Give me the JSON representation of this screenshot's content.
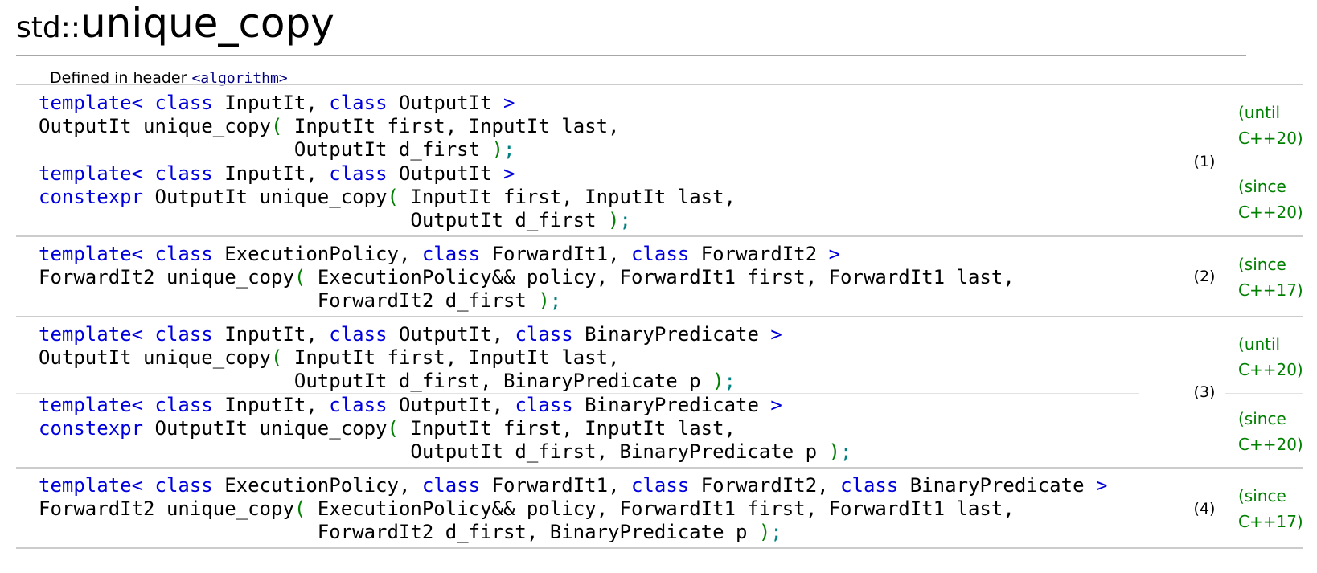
{
  "title": {
    "ns": "std::",
    "name": "unique_copy"
  },
  "header": {
    "prefix": "Defined in header ",
    "name": "<algorithm>"
  },
  "kw": {
    "template": "template",
    "class": "class",
    "constexpr": "constexpr"
  },
  "punct": {
    "lt": "< ",
    "gt": " >",
    "comma": ", ",
    "lp": "( ",
    "rp": " )",
    "semi": ";"
  },
  "decl": {
    "fn": "unique_copy",
    "t_in_out": "InputIt",
    "t_out": "OutputIt",
    "t_exec": "ExecutionPolicy",
    "t_fwd1": "ForwardIt1",
    "t_fwd2": "ForwardIt2",
    "t_pred": "BinaryPredicate",
    "p_first_in": "InputIt first",
    "p_last_in": "InputIt last",
    "p_dfirst_out": "OutputIt d_first",
    "p_policy": "ExecutionPolicy&& policy",
    "p_first_fwd": "ForwardIt1 first",
    "p_last_fwd": "ForwardIt1 last",
    "p_dfirst_fwd": "ForwardIt2 d_first",
    "p_pred": "BinaryPredicate p"
  },
  "overloads": [
    {
      "num": "(1)",
      "std_a": [
        "(until",
        "C++20)"
      ],
      "std_b": [
        "(since",
        "C++20)"
      ]
    },
    {
      "num": "(2)",
      "std": [
        "(since",
        "C++17)"
      ]
    },
    {
      "num": "(3)",
      "std_a": [
        "(until",
        "C++20)"
      ],
      "std_b": [
        "(since",
        "C++20)"
      ]
    },
    {
      "num": "(4)",
      "std": [
        "(since",
        "C++17)"
      ]
    }
  ]
}
